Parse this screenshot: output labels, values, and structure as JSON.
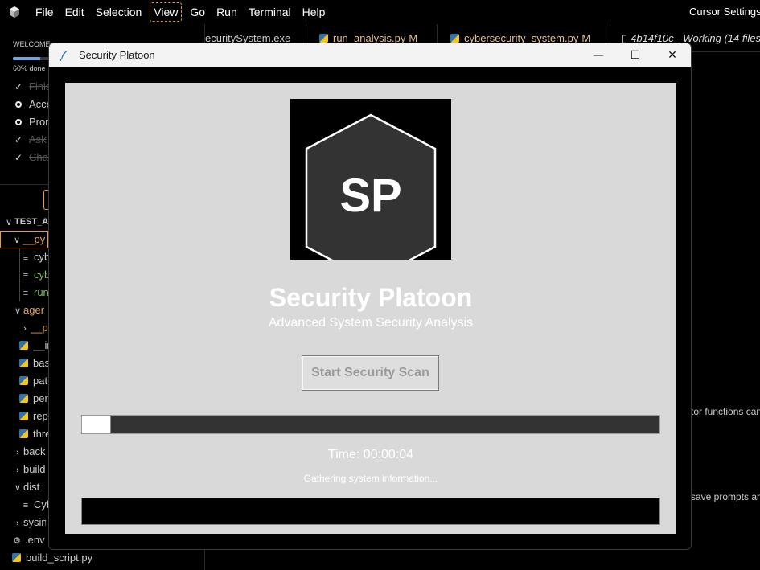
{
  "menubar": {
    "items": [
      "File",
      "Edit",
      "Selection",
      "View",
      "Go",
      "Run",
      "Terminal",
      "Help"
    ],
    "focused_index": 3,
    "right_label": "Cursor Settings -"
  },
  "tabs": [
    {
      "label": "ecuritySystem.exe",
      "kind": "exe"
    },
    {
      "label": "run_analysis.py",
      "badge": "M",
      "kind": "py"
    },
    {
      "label": "cybersecurity_system.py",
      "badge": "M",
      "kind": "py"
    },
    {
      "label": "4b14f10c - Working (14 files",
      "kind": "working"
    }
  ],
  "welcome": {
    "title": "WELCOME",
    "progress": 0.6,
    "progress_label": "60% done",
    "items": [
      {
        "label": "Finis",
        "done": true
      },
      {
        "label": "Acce",
        "done": false
      },
      {
        "label": "Pron",
        "done": false
      },
      {
        "label": "Ask",
        "done": true
      },
      {
        "label": "Chat",
        "done": true
      }
    ]
  },
  "explorer": {
    "rows": [
      {
        "label": "TEST_AI",
        "type": "root",
        "chevron": "down"
      },
      {
        "label": "__py",
        "type": "folder",
        "chevron": "down",
        "color": "orange",
        "selected": true
      },
      {
        "label": "cyb",
        "type": "file",
        "icon": "lines"
      },
      {
        "label": "cyb",
        "type": "file",
        "icon": "lines",
        "color": "green"
      },
      {
        "label": "run",
        "type": "file",
        "icon": "lines",
        "color": "green"
      },
      {
        "label": "agen",
        "type": "folder",
        "chevron": "down",
        "color": "orange"
      },
      {
        "label": "__p",
        "type": "folder",
        "chevron": "right",
        "color": "orange"
      },
      {
        "label": "__in",
        "type": "file",
        "icon": "python"
      },
      {
        "label": "bas",
        "type": "file",
        "icon": "python"
      },
      {
        "label": "pat",
        "type": "file",
        "icon": "python"
      },
      {
        "label": "per",
        "type": "file",
        "icon": "python"
      },
      {
        "label": "rep",
        "type": "file",
        "icon": "python"
      },
      {
        "label": "thre",
        "type": "file",
        "icon": "python"
      },
      {
        "label": "back",
        "type": "folder",
        "chevron": "right"
      },
      {
        "label": "build",
        "type": "folder",
        "chevron": "right"
      },
      {
        "label": "dist",
        "type": "folder",
        "chevron": "down"
      },
      {
        "label": "Cyb",
        "type": "file",
        "icon": "lines"
      },
      {
        "label": "sysin",
        "type": "folder",
        "chevron": "right"
      },
      {
        "label": ".env",
        "type": "file",
        "icon": "gear"
      },
      {
        "label": "build_script.py",
        "type": "file",
        "icon": "python"
      }
    ]
  },
  "editor_fragments": [
    "tor functions can",
    "save prompts an"
  ],
  "dialog": {
    "window_title": "Security Platoon",
    "logo_text": "SP",
    "app_title": "Security Platoon",
    "app_subtitle": "Advanced System Security Analysis",
    "scan_button": "Start Security Scan",
    "progress": 0.05,
    "time_label": "Time: 00:00:04",
    "status": "Gathering system information...",
    "controls": {
      "minimize": "—",
      "maximize": "☐",
      "close": "✕"
    }
  },
  "colors": {
    "accent_orange": "#e89a3c",
    "dialog_bg": "#d9d9d9",
    "progress_track": "#333333",
    "logo_hex_fill": "#333333",
    "git_modified": "#e2c08d",
    "git_added": "#7fbf6a"
  }
}
